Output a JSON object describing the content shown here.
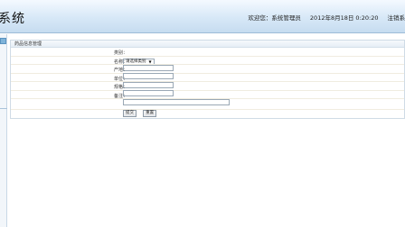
{
  "header": {
    "app_title": "系统",
    "welcome": "欢迎您：系统管理员",
    "datetime": "2012年8月18日  0:20:20",
    "logout": "注销系"
  },
  "panel": {
    "title": "药品信息管理"
  },
  "form": {
    "category_label": "类别：",
    "category_value": "请选择类别",
    "name_label": "名称：",
    "origin_label": "产地：",
    "unit_label": "单位：",
    "spec_label": "规格：",
    "remark_label": "备注：",
    "submit_label": "提交",
    "reset_label": "重置"
  }
}
